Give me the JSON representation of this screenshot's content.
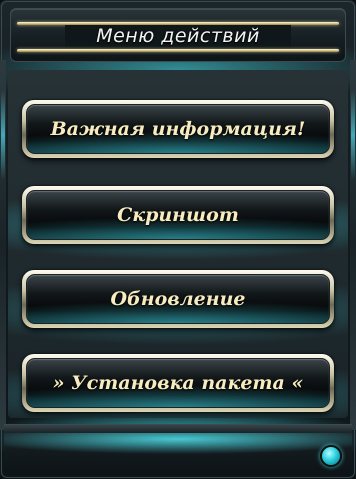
{
  "window": {
    "title": "Меню действий"
  },
  "menu": {
    "items": [
      {
        "label": "Важная информация!"
      },
      {
        "label": "Скриншот"
      },
      {
        "label": "Обновление"
      },
      {
        "label": "»  Установка пакета  «"
      }
    ]
  },
  "footer": {
    "status_icon": "status-led-icon"
  },
  "colors": {
    "accent_glow": "#46e6f0",
    "button_text": "#f7ecc0",
    "title_text": "#f3f3f3",
    "trim_gold": "#d9c88a"
  }
}
